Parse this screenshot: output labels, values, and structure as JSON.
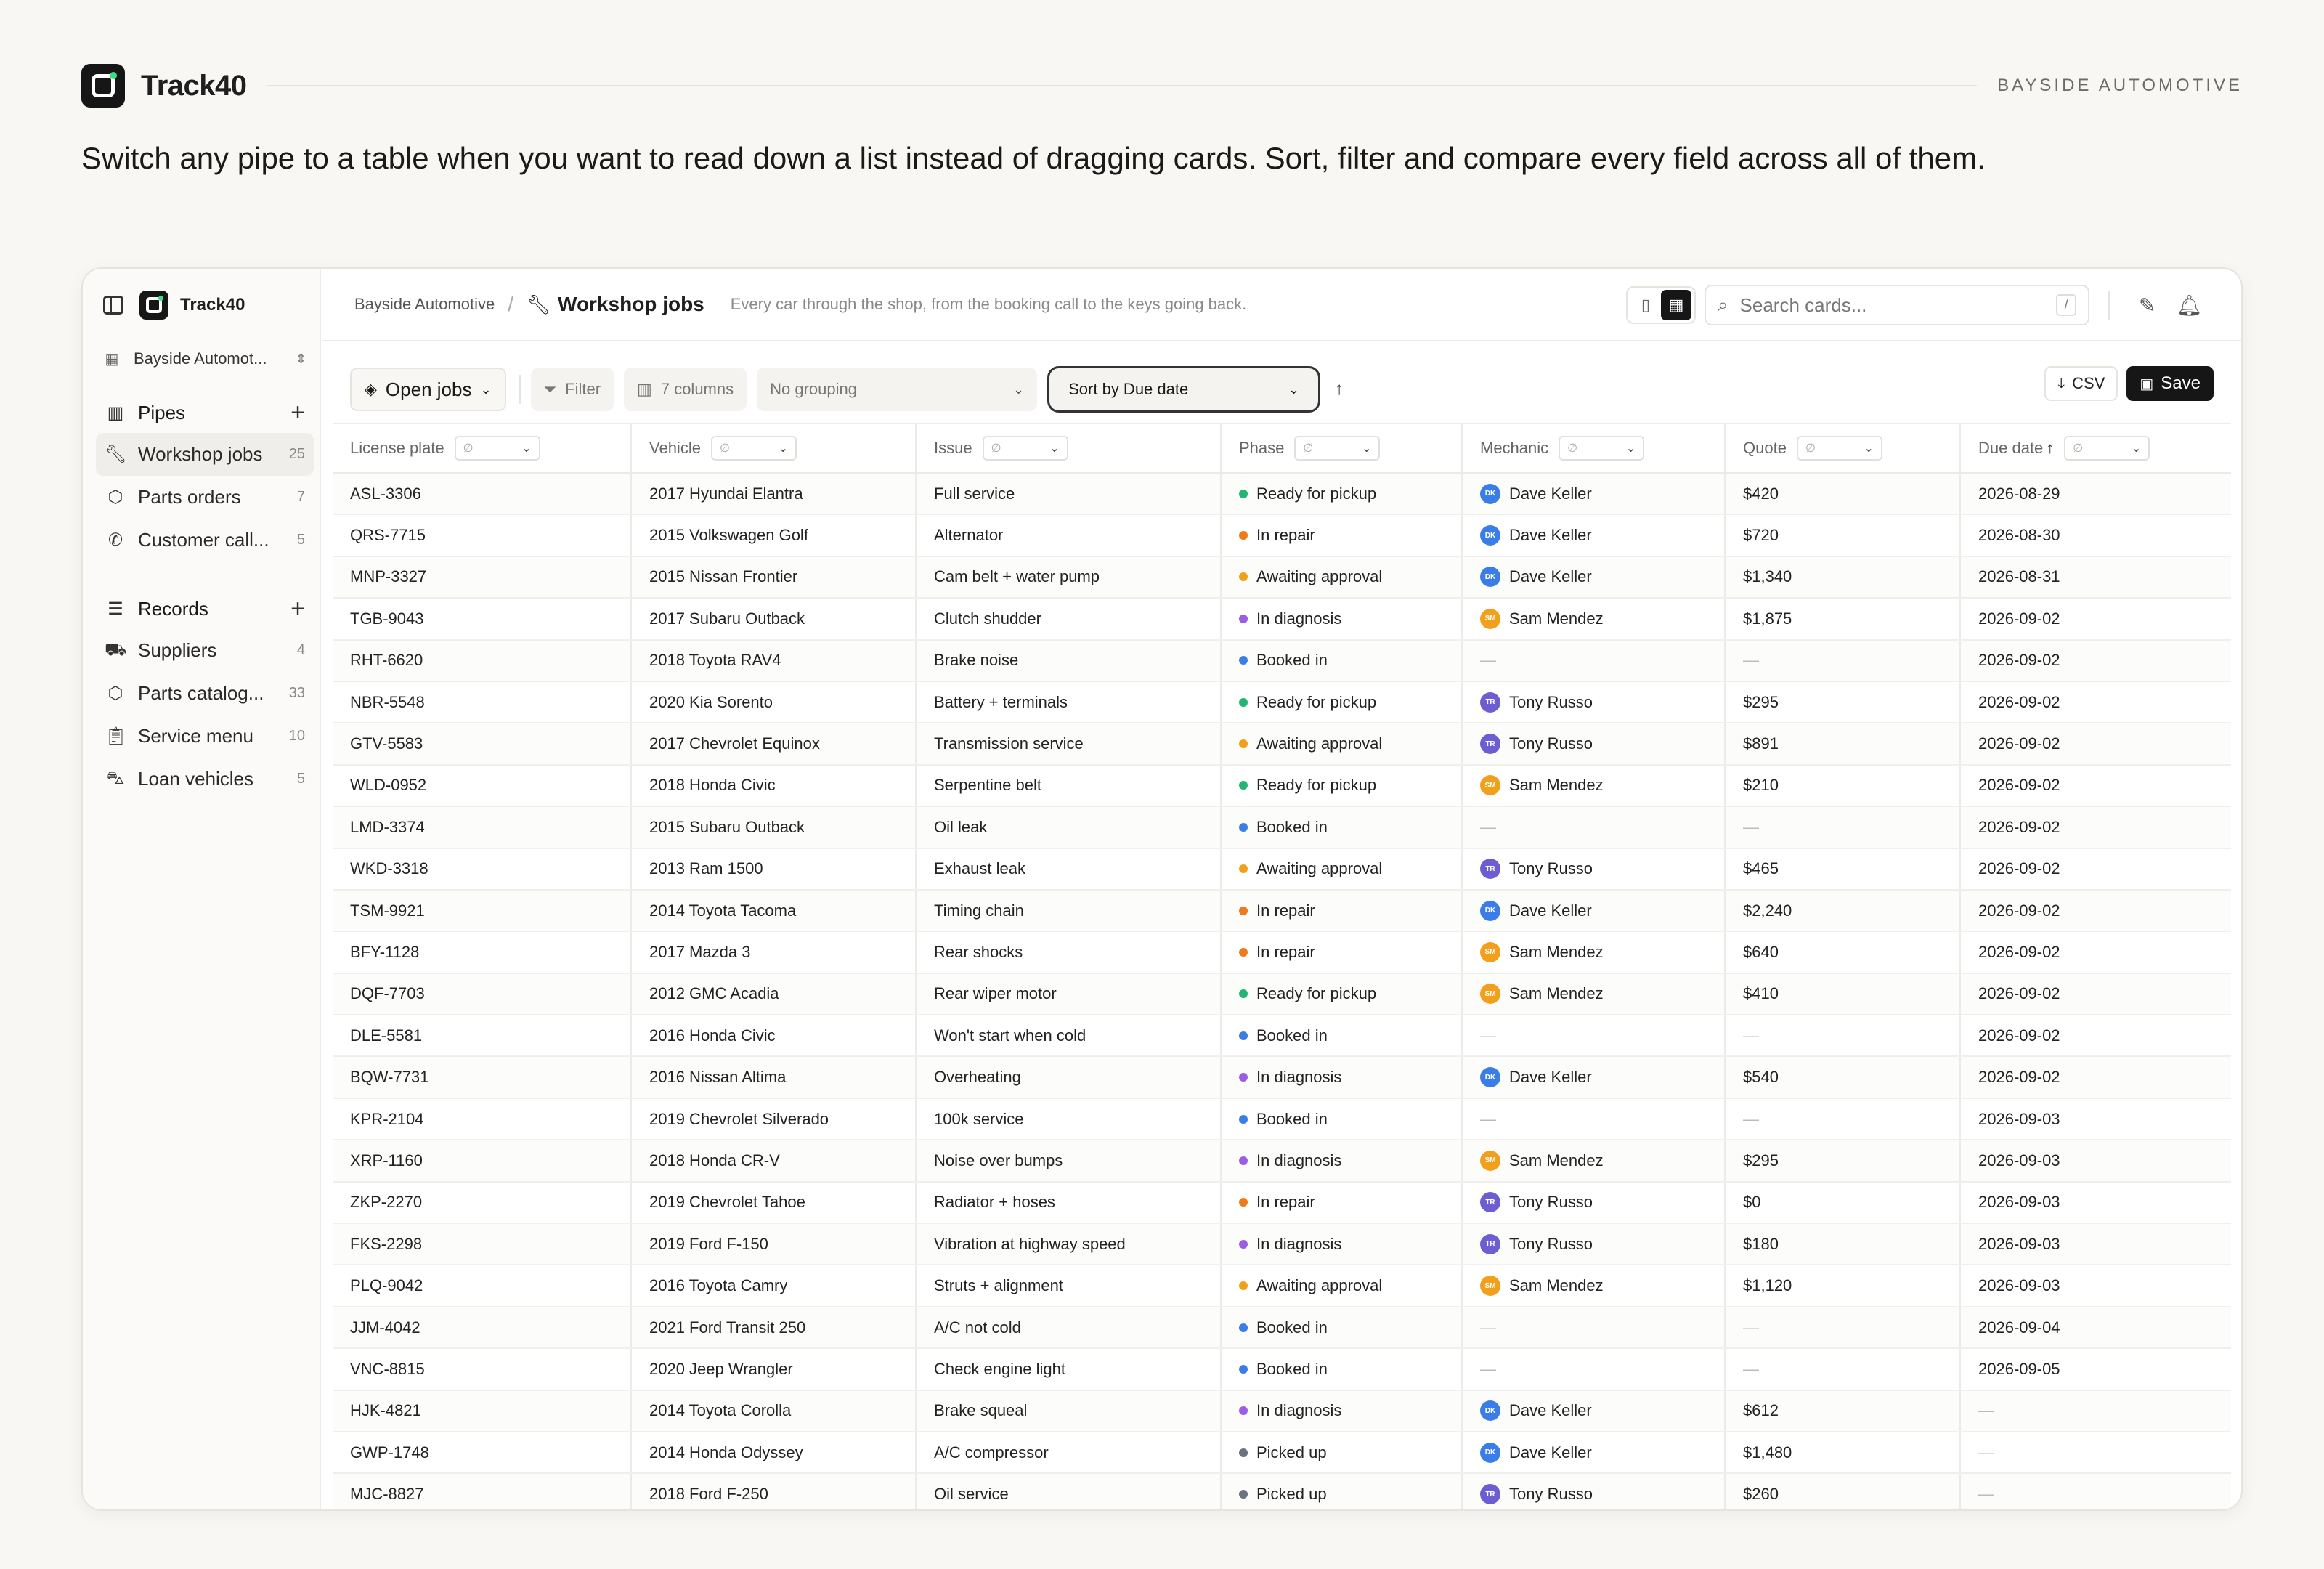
{
  "brand": {
    "name": "Track40",
    "org": "BAYSIDE AUTOMOTIVE"
  },
  "headline": "Switch any pipe to a table when you want to read down a list instead of dragging cards. Sort, filter and compare every field across all of them.",
  "sidebar": {
    "app_name": "Track40",
    "workspace": "Bayside Automot...",
    "pipes_header": "Pipes",
    "pipes": [
      {
        "label": "Workshop jobs",
        "count": "25",
        "icon": "wrench-icon"
      },
      {
        "label": "Parts orders",
        "count": "7",
        "icon": "box-icon"
      },
      {
        "label": "Customer call...",
        "count": "5",
        "icon": "phone-icon"
      }
    ],
    "records_header": "Records",
    "records": [
      {
        "label": "Suppliers",
        "count": "4",
        "icon": "truck-icon"
      },
      {
        "label": "Parts catalog...",
        "count": "33",
        "icon": "box-icon"
      },
      {
        "label": "Service menu",
        "count": "10",
        "icon": "clipboard-icon"
      },
      {
        "label": "Loan vehicles",
        "count": "5",
        "icon": "car-icon"
      }
    ]
  },
  "topbar": {
    "org": "Bayside Automotive",
    "page": "Workshop jobs",
    "description": "Every car through the shop, from the booking call to the keys going back.",
    "search_placeholder": "Search cards...",
    "search_shortcut": "/"
  },
  "toolbar": {
    "view": "Open jobs",
    "filter": "Filter",
    "columns": "7 columns",
    "grouping": "No grouping",
    "sort": "Sort by Due date",
    "csv": "CSV",
    "save": "Save"
  },
  "table": {
    "filter_placeholder": "∅",
    "columns": [
      "License plate",
      "Vehicle",
      "Issue",
      "Phase",
      "Mechanic",
      "Quote",
      "Due date"
    ],
    "phase_colors": {
      "Ready for pickup": "#22b573",
      "In repair": "#f07a1a",
      "Awaiting approval": "#f2a01c",
      "In diagnosis": "#9b5de5",
      "Booked in": "#3b7de8",
      "Picked up": "#6b7280"
    },
    "mechanics": {
      "Dave Keller": {
        "initials": "DK",
        "color": "#3b7de8"
      },
      "Sam Mendez": {
        "initials": "SM",
        "color": "#f2a01c"
      },
      "Tony Russo": {
        "initials": "TR",
        "color": "#6d5dd3"
      }
    },
    "rows": [
      [
        "ASL-3306",
        "2017 Hyundai Elantra",
        "Full service",
        "Ready for pickup",
        "Dave Keller",
        "$420",
        "2026-08-29"
      ],
      [
        "QRS-7715",
        "2015 Volkswagen Golf",
        "Alternator",
        "In repair",
        "Dave Keller",
        "$720",
        "2026-08-30"
      ],
      [
        "MNP-3327",
        "2015 Nissan Frontier",
        "Cam belt + water pump",
        "Awaiting approval",
        "Dave Keller",
        "$1,340",
        "2026-08-31"
      ],
      [
        "TGB-9043",
        "2017 Subaru Outback",
        "Clutch shudder",
        "In diagnosis",
        "Sam Mendez",
        "$1,875",
        "2026-09-02"
      ],
      [
        "RHT-6620",
        "2018 Toyota RAV4",
        "Brake noise",
        "Booked in",
        "—",
        "—",
        "2026-09-02"
      ],
      [
        "NBR-5548",
        "2020 Kia Sorento",
        "Battery + terminals",
        "Ready for pickup",
        "Tony Russo",
        "$295",
        "2026-09-02"
      ],
      [
        "GTV-5583",
        "2017 Chevrolet Equinox",
        "Transmission service",
        "Awaiting approval",
        "Tony Russo",
        "$891",
        "2026-09-02"
      ],
      [
        "WLD-0952",
        "2018 Honda Civic",
        "Serpentine belt",
        "Ready for pickup",
        "Sam Mendez",
        "$210",
        "2026-09-02"
      ],
      [
        "LMD-3374",
        "2015 Subaru Outback",
        "Oil leak",
        "Booked in",
        "—",
        "—",
        "2026-09-02"
      ],
      [
        "WKD-3318",
        "2013 Ram 1500",
        "Exhaust leak",
        "Awaiting approval",
        "Tony Russo",
        "$465",
        "2026-09-02"
      ],
      [
        "TSM-9921",
        "2014 Toyota Tacoma",
        "Timing chain",
        "In repair",
        "Dave Keller",
        "$2,240",
        "2026-09-02"
      ],
      [
        "BFY-1128",
        "2017 Mazda 3",
        "Rear shocks",
        "In repair",
        "Sam Mendez",
        "$640",
        "2026-09-02"
      ],
      [
        "DQF-7703",
        "2012 GMC Acadia",
        "Rear wiper motor",
        "Ready for pickup",
        "Sam Mendez",
        "$410",
        "2026-09-02"
      ],
      [
        "DLE-5581",
        "2016 Honda Civic",
        "Won't start when cold",
        "Booked in",
        "—",
        "—",
        "2026-09-02"
      ],
      [
        "BQW-7731",
        "2016 Nissan Altima",
        "Overheating",
        "In diagnosis",
        "Dave Keller",
        "$540",
        "2026-09-02"
      ],
      [
        "KPR-2104",
        "2019 Chevrolet Silverado",
        "100k service",
        "Booked in",
        "—",
        "—",
        "2026-09-03"
      ],
      [
        "XRP-1160",
        "2018 Honda CR-V",
        "Noise over bumps",
        "In diagnosis",
        "Sam Mendez",
        "$295",
        "2026-09-03"
      ],
      [
        "ZKP-2270",
        "2019 Chevrolet Tahoe",
        "Radiator + hoses",
        "In repair",
        "Tony Russo",
        "$0",
        "2026-09-03"
      ],
      [
        "FKS-2298",
        "2019 Ford F-150",
        "Vibration at highway speed",
        "In diagnosis",
        "Tony Russo",
        "$180",
        "2026-09-03"
      ],
      [
        "PLQ-9042",
        "2016 Toyota Camry",
        "Struts + alignment",
        "Awaiting approval",
        "Sam Mendez",
        "$1,120",
        "2026-09-03"
      ],
      [
        "JJM-4042",
        "2021 Ford Transit 250",
        "A/C not cold",
        "Booked in",
        "—",
        "—",
        "2026-09-04"
      ],
      [
        "VNC-8815",
        "2020 Jeep Wrangler",
        "Check engine light",
        "Booked in",
        "—",
        "—",
        "2026-09-05"
      ],
      [
        "HJK-4821",
        "2014 Toyota Corolla",
        "Brake squeal",
        "In diagnosis",
        "Dave Keller",
        "$612",
        "—"
      ],
      [
        "GWP-1748",
        "2014 Honda Odyssey",
        "A/C compressor",
        "Picked up",
        "Dave Keller",
        "$1,480",
        "—"
      ],
      [
        "MJC-8827",
        "2018 Ford F-250",
        "Oil service",
        "Picked up",
        "Tony Russo",
        "$260",
        "—"
      ]
    ]
  }
}
